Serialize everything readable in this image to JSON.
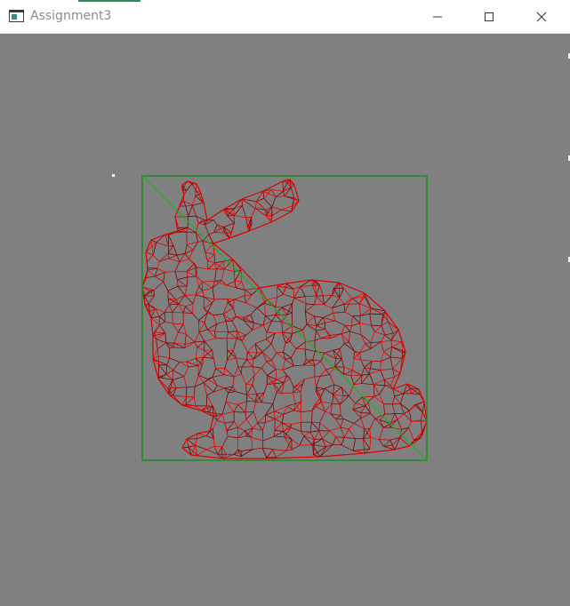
{
  "window": {
    "title": "Assignment3",
    "icon": "console-window-icon",
    "controls": [
      "minimize-icon",
      "maximize-icon",
      "close-icon"
    ]
  },
  "scene": {
    "background": "#808080",
    "mesh_color": "#ff0000",
    "bounding_box_color": "#1e8c1e",
    "diagonal_color": "#22aa22",
    "point_color": "#ffffff"
  }
}
